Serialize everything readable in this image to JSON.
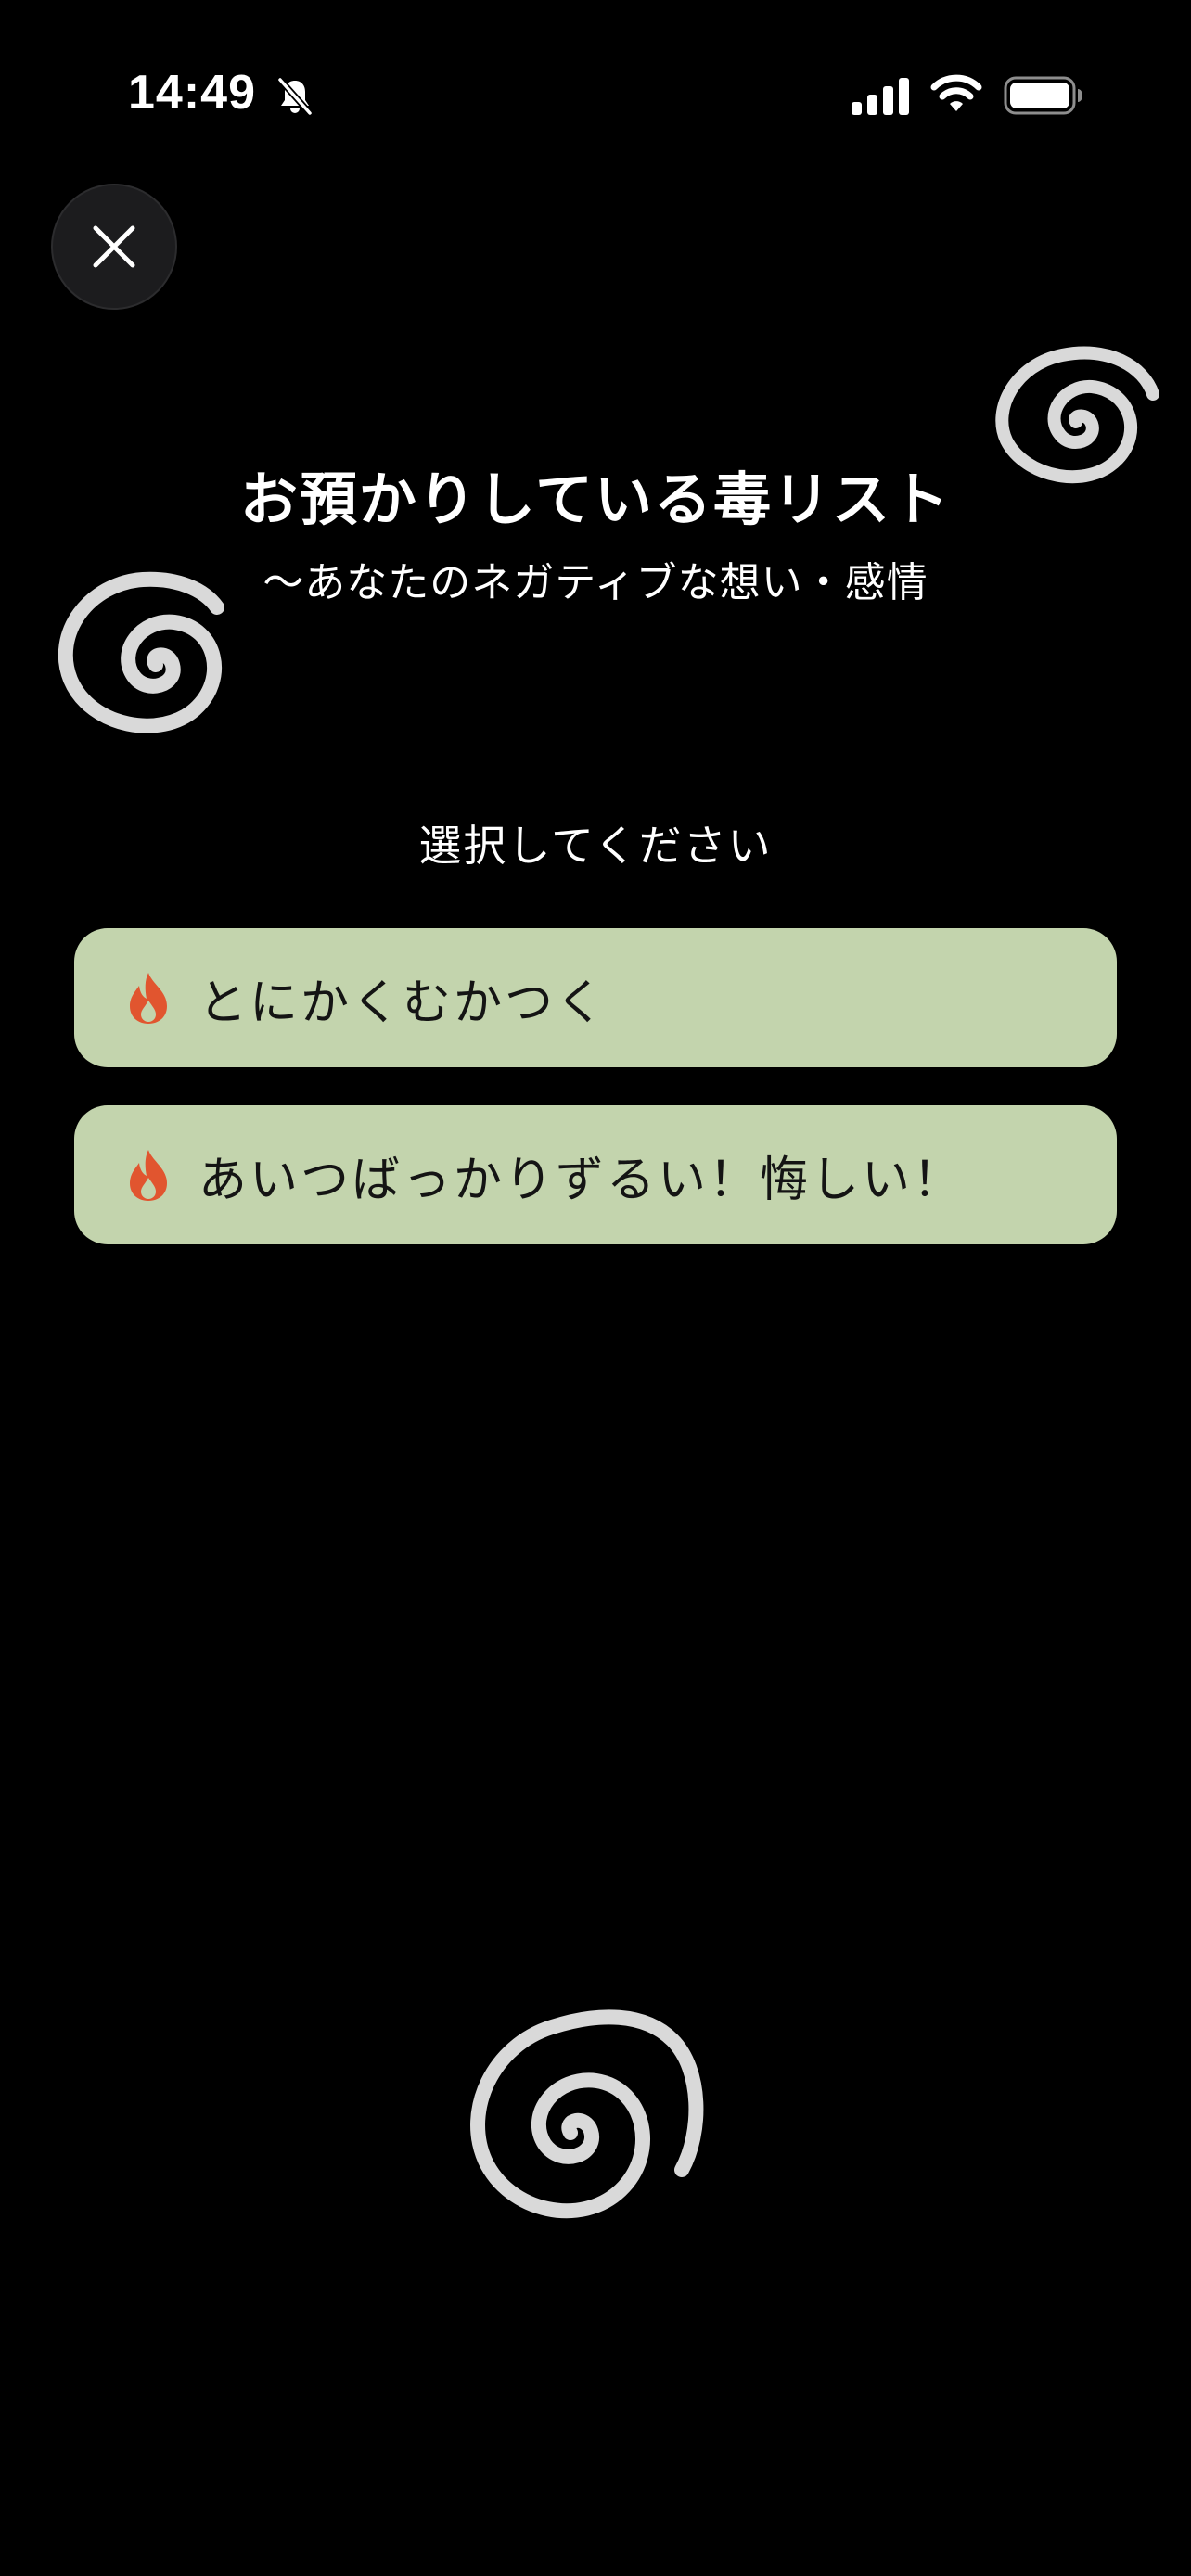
{
  "status_bar": {
    "time": "14:49",
    "icons": [
      "bell-slash-icon",
      "cellular-signal-icon",
      "wifi-icon",
      "battery-icon"
    ]
  },
  "header": {
    "close_icon": "close-icon",
    "title": "お預かりしている毒リスト",
    "subtitle": "〜あなたのネガティブな想い・感情"
  },
  "main": {
    "prompt": "選択してください",
    "options": [
      {
        "icon": "flame-icon",
        "label": "とにかくむかつく"
      },
      {
        "icon": "flame-icon",
        "label": "あいつばっかりずるい！悔しい！"
      }
    ]
  },
  "decorations": [
    "swirl-icon",
    "swirl-icon",
    "swirl-icon"
  ],
  "colors": {
    "background": "#000000",
    "option_background": "#c3d4ad",
    "flame": "#e1552f",
    "swirl": "#d9d9d9"
  }
}
